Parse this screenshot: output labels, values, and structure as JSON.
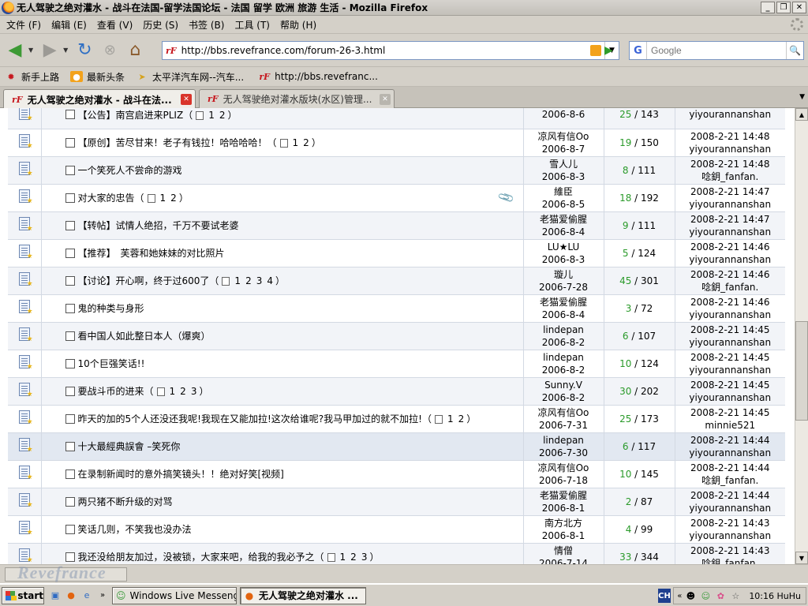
{
  "window": {
    "title": "无人驾驶之绝对灌水 - 战斗在法国-留学法国论坛 - 法国 留学 欧洲 旅游 生活 - Mozilla Firefox",
    "minimize": "_",
    "maximize": "❐",
    "close": "✕"
  },
  "menu": [
    "文件 (F)",
    "编辑 (E)",
    "查看 (V)",
    "历史 (S)",
    "书签 (B)",
    "工具 (T)",
    "帮助 (H)"
  ],
  "nav": {
    "url": "http://bbs.revefrance.com/forum-26-3.html",
    "search_placeholder": "Google",
    "site_icon": "rF"
  },
  "bookmarks": [
    {
      "label": "新手上路",
      "icon": "firefox-icon"
    },
    {
      "label": "最新头条",
      "icon": "rss-icon"
    },
    {
      "label": "太平洋汽车网--汽车...",
      "icon": "car-icon"
    },
    {
      "label": "http://bbs.revefranc...",
      "icon": "revefrance-icon"
    }
  ],
  "tabs": [
    {
      "label": "无人驾驶之绝对灌水 - 战斗在法...",
      "active": true
    },
    {
      "label": "无人驾驶绝对灌水版块(水区)管理...",
      "active": false
    }
  ],
  "threads": [
    {
      "subject": "【公告】南宫启进来PLIZ",
      "pages": [
        "1",
        "2"
      ],
      "author": "",
      "date": "2006-8-6",
      "replies": "25",
      "views": "143",
      "last_time": "",
      "last_user": "yiyourannanshan",
      "attach": false
    },
    {
      "subject": "【原创】苦尽甘来！老子有钱拉！哈哈哈哈！",
      "pages": [
        "1",
        "2"
      ],
      "author": "凉风有信Oo",
      "date": "2006-8-7",
      "replies": "19",
      "views": "150",
      "last_time": "2008-2-21 14:48",
      "last_user": "yiyourannanshan",
      "attach": false
    },
    {
      "subject": "一个笑死人不尝命的游戏",
      "pages": [],
      "author": "雪人儿",
      "date": "2006-8-3",
      "replies": "8",
      "views": "111",
      "last_time": "2008-2-21 14:48",
      "last_user": "唸鈅_fanfan.",
      "attach": false
    },
    {
      "subject": "对大家的忠告",
      "pages": [
        "1",
        "2"
      ],
      "author": "維臣",
      "date": "2006-8-5",
      "replies": "18",
      "views": "192",
      "last_time": "2008-2-21 14:47",
      "last_user": "yiyourannanshan",
      "attach": true
    },
    {
      "subject": "【转帖】试情人绝招，千万不要试老婆",
      "pages": [],
      "author": "老猫爱偷腥",
      "date": "2006-8-4",
      "replies": "9",
      "views": "111",
      "last_time": "2008-2-21 14:47",
      "last_user": "yiyourannanshan",
      "attach": false
    },
    {
      "subject": "【推荐】　芙蓉和她妹妹的对比照片",
      "pages": [],
      "author": "LU★LU",
      "date": "2006-8-3",
      "replies": "5",
      "views": "124",
      "last_time": "2008-2-21 14:46",
      "last_user": "yiyourannanshan",
      "attach": false
    },
    {
      "subject": "【讨论】开心啊，终于过600了",
      "pages": [
        "1",
        "2",
        "3",
        "4"
      ],
      "author": "璇儿",
      "date": "2006-7-28",
      "replies": "45",
      "views": "301",
      "last_time": "2008-2-21 14:46",
      "last_user": "唸鈅_fanfan.",
      "attach": false
    },
    {
      "subject": "鬼的种类与身形",
      "pages": [],
      "author": "老猫爱偷腥",
      "date": "2006-8-4",
      "replies": "3",
      "views": "72",
      "last_time": "2008-2-21 14:46",
      "last_user": "yiyourannanshan",
      "attach": false
    },
    {
      "subject": "看中国人如此整日本人（爆爽）",
      "pages": [],
      "author": "lindepan",
      "date": "2006-8-2",
      "replies": "6",
      "views": "107",
      "last_time": "2008-2-21 14:45",
      "last_user": "yiyourannanshan",
      "attach": false
    },
    {
      "subject": "10个巨强笑话!!",
      "pages": [],
      "author": "lindepan",
      "date": "2006-8-2",
      "replies": "10",
      "views": "124",
      "last_time": "2008-2-21 14:45",
      "last_user": "yiyourannanshan",
      "attach": false
    },
    {
      "subject": "要战斗币的进来",
      "pages": [
        "1",
        "2",
        "3"
      ],
      "author": "Sunny.V",
      "date": "2006-8-2",
      "replies": "30",
      "views": "202",
      "last_time": "2008-2-21 14:45",
      "last_user": "yiyourannanshan",
      "attach": false
    },
    {
      "subject": "昨天的加的5个人还没还我呢!我现在又能加拉!这次给谁呢?我马甲加过的就不加拉!",
      "pages": [
        "1",
        "2"
      ],
      "author": "凉风有信Oo",
      "date": "2006-7-31",
      "replies": "25",
      "views": "173",
      "last_time": "2008-2-21 14:45",
      "last_user": "minnie521",
      "attach": false
    },
    {
      "subject": "十大最經典誤會 –笑死你",
      "pages": [],
      "author": "lindepan",
      "date": "2006-7-30",
      "replies": "6",
      "views": "117",
      "last_time": "2008-2-21 14:44",
      "last_user": "yiyourannanshan",
      "attach": false,
      "highlight": true
    },
    {
      "subject": "在录制新闻时的意外搞笑镜头！！绝对好笑[视频]",
      "pages": [],
      "author": "凉风有信Oo",
      "date": "2006-7-18",
      "replies": "10",
      "views": "145",
      "last_time": "2008-2-21 14:44",
      "last_user": "唸鈅_fanfan.",
      "attach": false
    },
    {
      "subject": "两只猪不断升级的对骂",
      "pages": [],
      "author": "老猫爱偷腥",
      "date": "2006-8-1",
      "replies": "2",
      "views": "87",
      "last_time": "2008-2-21 14:44",
      "last_user": "yiyourannanshan",
      "attach": false
    },
    {
      "subject": "笑话几则，不笑我也没办法",
      "pages": [],
      "author": "南方北方",
      "date": "2006-8-1",
      "replies": "4",
      "views": "99",
      "last_time": "2008-2-21 14:43",
      "last_user": "yiyourannanshan",
      "attach": false
    },
    {
      "subject": "我还没给朋友加过，没被锁，大家来吧，给我的我必予之",
      "pages": [
        "1",
        "2",
        "3"
      ],
      "author": "情僧",
      "date": "2006-7-14",
      "replies": "33",
      "views": "344",
      "last_time": "2008-2-21 14:43",
      "last_user": "唸鈅_fanfan.",
      "attach": false
    }
  ],
  "status": {
    "watermark": "Revefrance"
  },
  "taskbar": {
    "start": "start",
    "buttons": [
      {
        "label": "Windows Live Messenger",
        "active": false
      },
      {
        "label": "无人驾驶之绝对灌水 ...",
        "active": true
      }
    ],
    "lang": "CH",
    "clock": "10:16 HuHu"
  },
  "colors": {
    "reply_count": "#2a9a2a",
    "close_tab": "#d9342b"
  }
}
